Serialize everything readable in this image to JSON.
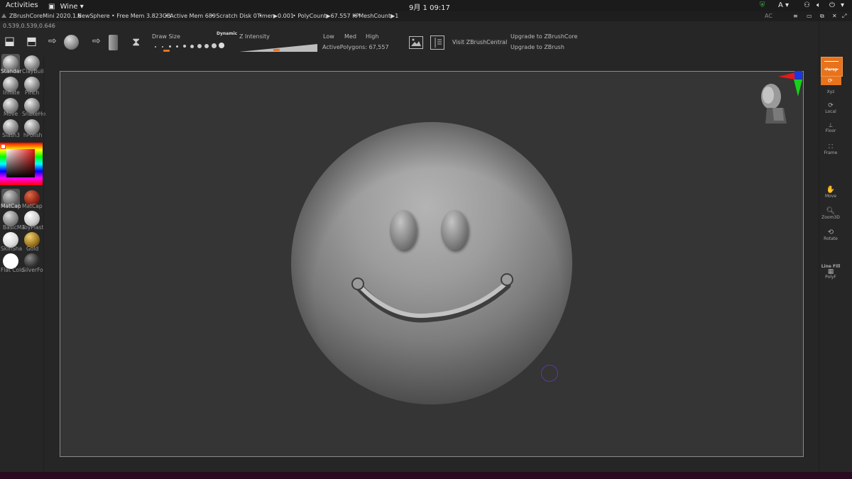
{
  "topbar": {
    "activities": "Activities",
    "wine": "Wine ▾",
    "datetime": "9月 1  09:17",
    "lang": "A ▾"
  },
  "titlebar": {
    "app": "ZBrushCoreMini 2020.1.6",
    "doc": "NewSphere",
    "freemem": "• Free Mem 3.823GB",
    "activemem": "• Active Mem 689",
    "scratch": "• Scratch Disk 0 •",
    "timer": "Timer▶0.001",
    "polycount": "• PolyCount▶67.557 KP",
    "meshcount": "• MeshCount▶1",
    "ac": "AC"
  },
  "coords": "0.539,0.539,0.646",
  "toolbar": {
    "draw_size": "Draw Size",
    "dynamic": "Dynamic",
    "z_intensity": "Z Intensity",
    "low": "Low",
    "med": "Med",
    "high": "High",
    "active_polygons": "ActivePolygons: 67,557",
    "visit": "Visit ZBrushCentral",
    "upgrade_core": "Upgrade to ZBrushCore",
    "upgrade_zbrush": "Upgrade to ZBrush"
  },
  "brushes": [
    "Standar",
    "ClayBuil",
    "Inflate",
    "Pinch",
    "Move",
    "SnakeHo",
    "Slash3",
    "hPolish"
  ],
  "materials": [
    "MatCap",
    "MatCap",
    "BasicMa",
    "ToyPlast",
    "SkinSha",
    "Gold",
    "Flat Colo",
    "SilverFo"
  ],
  "right": {
    "persp": "Persp",
    "xyz": "Xyz",
    "local": "Local",
    "floor": "Floor",
    "frame": "Frame",
    "move": "Move",
    "zoom3d": "Zoom3D",
    "rotate": "Rotate",
    "linefill": "Line Fill",
    "polyf": "PolyF"
  },
  "colors": {
    "accent": "#e8731c",
    "desktop": "#2a0a1e"
  }
}
